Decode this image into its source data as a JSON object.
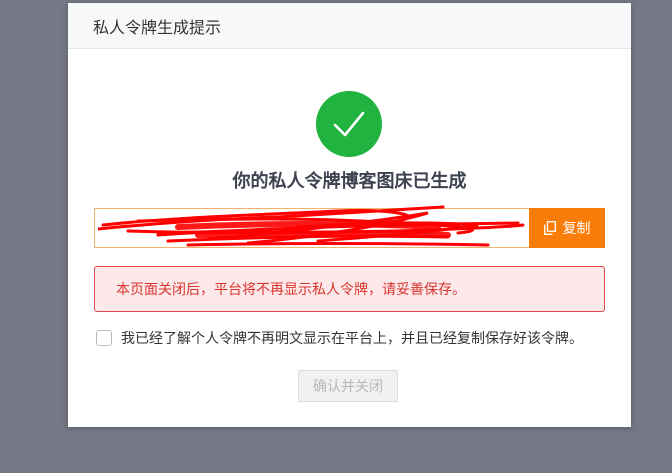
{
  "modal": {
    "title": "私人令牌生成提示",
    "headline": "你的私人令牌博客图床已生成",
    "token": {
      "value": ""
    },
    "copy_button": {
      "label": "复制",
      "icon": "copy-icon"
    },
    "success_icon": "check-circle-icon",
    "warning": "本页面关闭后，平台将不再显示私人令牌，请妥善保存。",
    "confirm": {
      "label": "我已经了解个人令牌不再明文显示在平台上，并且已经复制保存好该令牌。",
      "checked": false
    },
    "close_button": {
      "label": "确认并关闭",
      "disabled": true
    }
  },
  "colors": {
    "backdrop": "#757885",
    "success": "#21b33f",
    "accent": "#fa7d0a",
    "danger": "#d8352f",
    "danger_bg": "#fde9e9"
  }
}
